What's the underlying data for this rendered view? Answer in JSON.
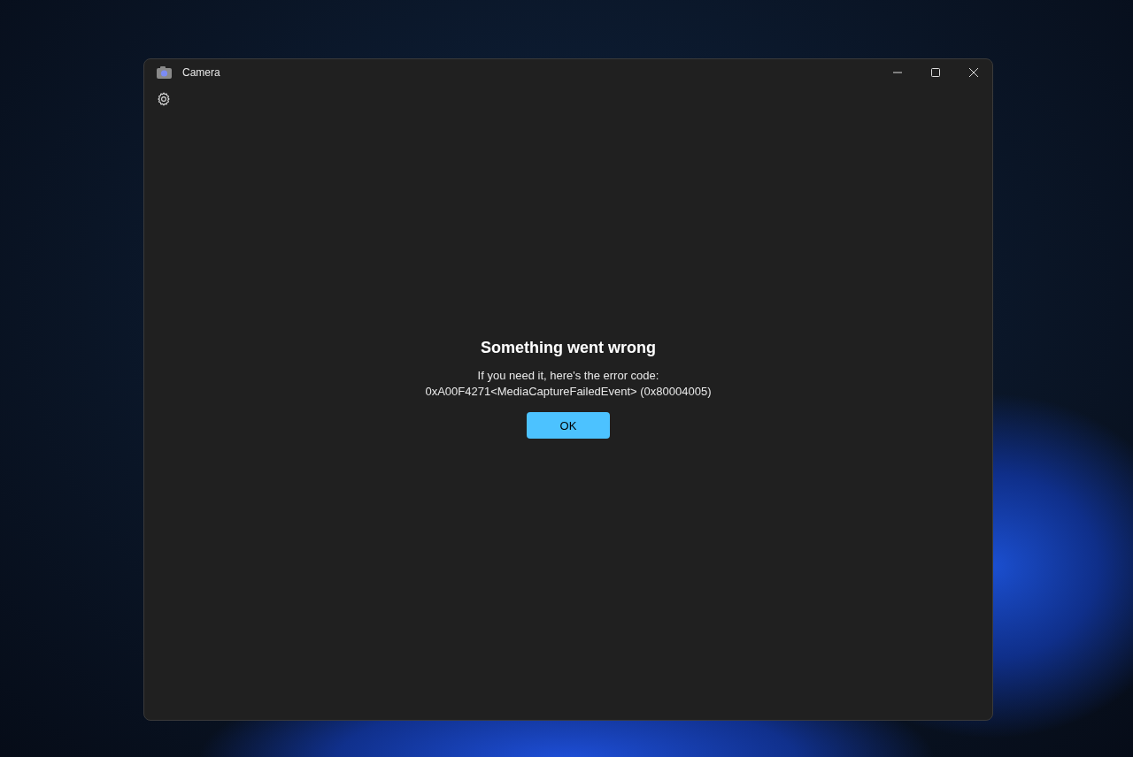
{
  "window": {
    "title": "Camera"
  },
  "dialog": {
    "title": "Something went wrong",
    "message": "If you need it, here's the error code:",
    "error_code": "0xA00F4271<MediaCaptureFailedEvent> (0x80004005)",
    "button": "OK"
  }
}
